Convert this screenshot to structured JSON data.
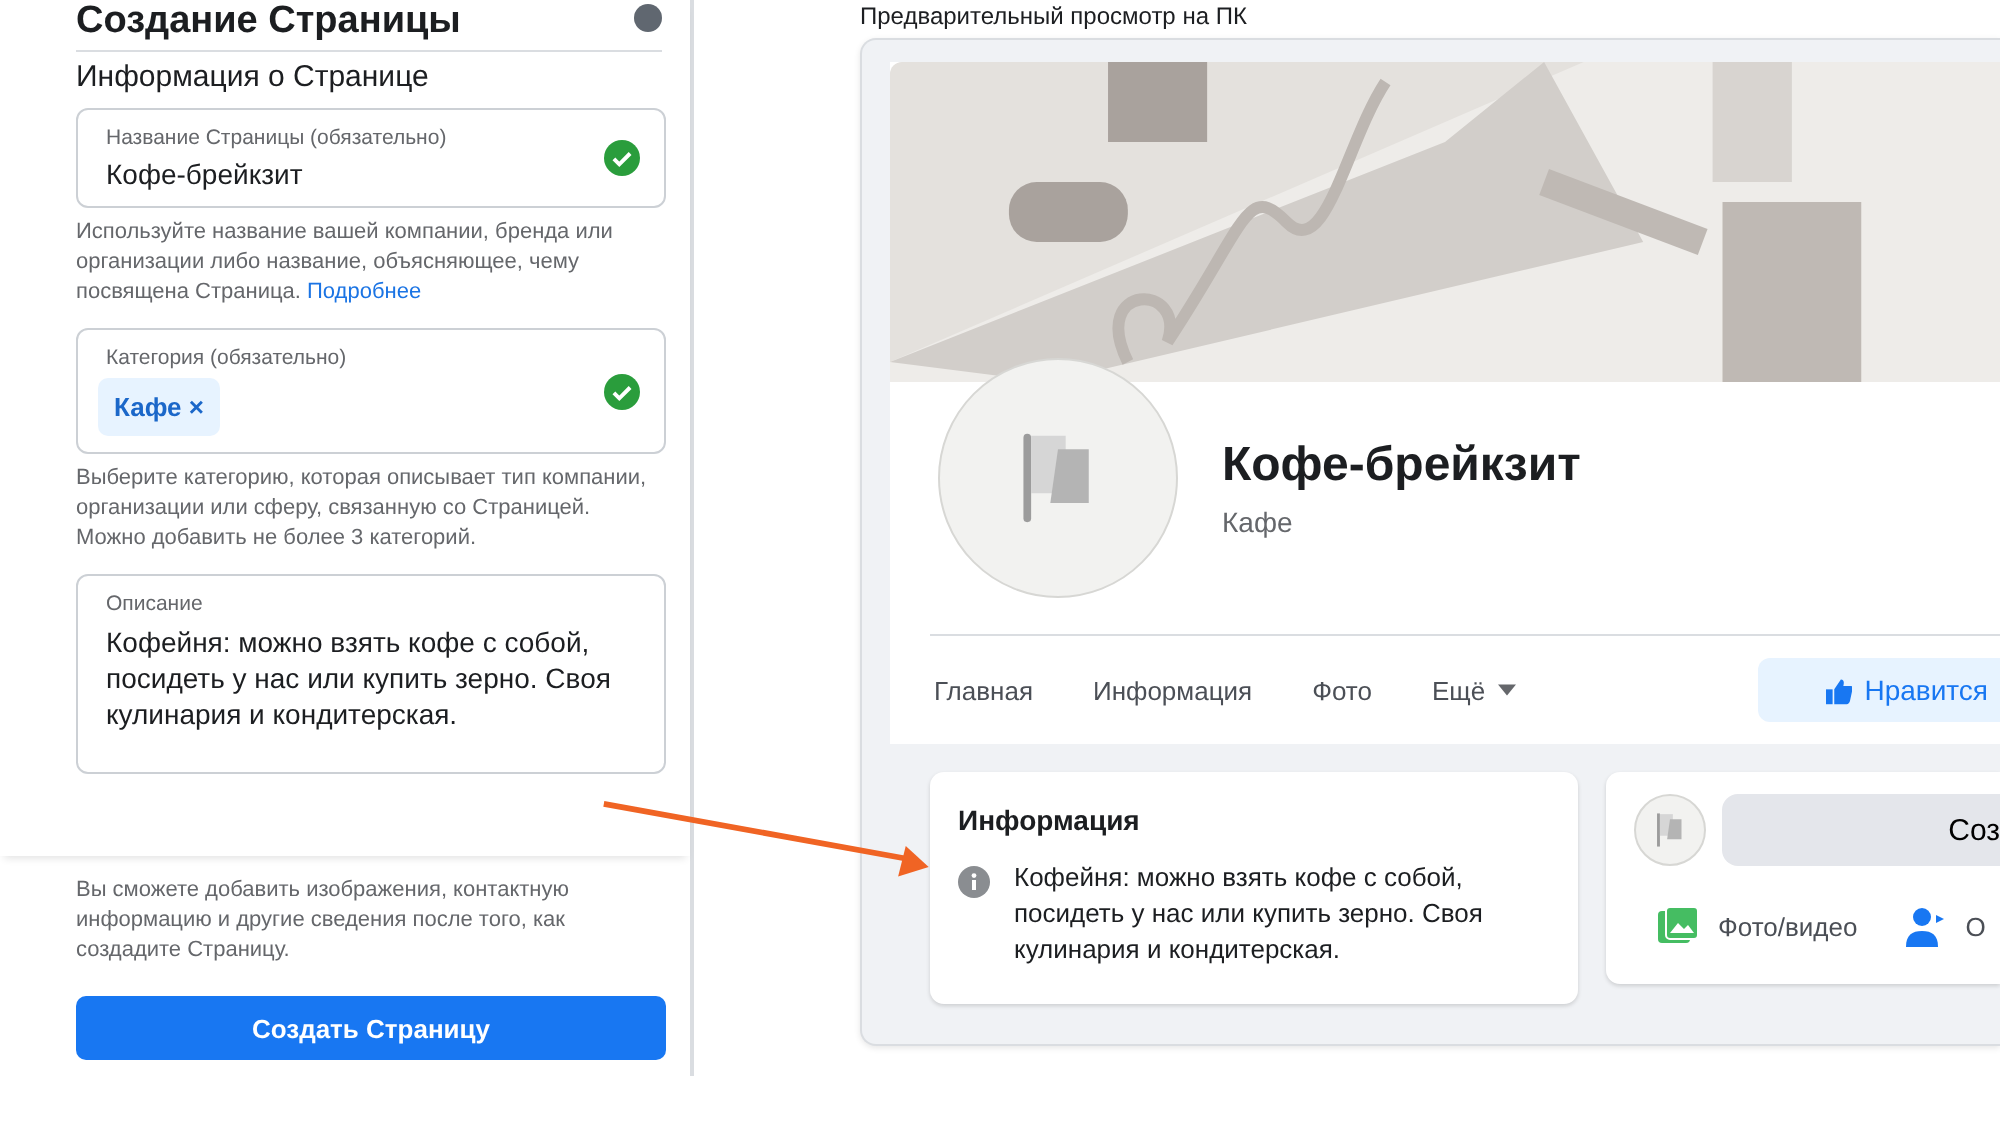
{
  "form": {
    "title": "Создание Страницы",
    "section": "Информация о Странице",
    "name_field": {
      "label": "Название Страницы (обязательно)",
      "value": "Кофе-брейкзит",
      "valid": true
    },
    "name_hint": "Используйте название вашей компании, бренда или организации либо название, объясняющее, чему посвящена Страница.",
    "name_hint_link": "Подробнее",
    "category_field": {
      "label": "Категория (обязательно)",
      "chips": [
        "Кафе"
      ],
      "remove": "×",
      "valid": true
    },
    "category_hint": "Выберите категорию, которая описывает тип компании, организации или сферу, связанную со Страницей. Можно добавить не более 3 категорий.",
    "description_field": {
      "label": "Описание",
      "value": "Кофейня: можно взять кофе с собой, посидеть у нас или купить зерно. Своя кулинария и кондитерская."
    },
    "footnote": "Вы сможете добавить изображения, контактную информацию и другие сведения после того, как создадите Страницу.",
    "submit": "Создать Страницу"
  },
  "preview": {
    "heading": "Предварительный просмотр на ПК",
    "page_name": "Кофе-брейкзит",
    "category": "Кафе",
    "tabs": [
      {
        "label": "Главная",
        "selected": false
      },
      {
        "label": "Информация",
        "selected": false
      },
      {
        "label": "Фото",
        "selected": false
      },
      {
        "label": "Ещё",
        "selected": false,
        "dropdown": true
      }
    ],
    "like_button": "Нравится",
    "info_card": {
      "title": "Информация",
      "text": "Кофейня: можно взять кофе с собой, посидеть у нас или купить зерно. Своя кулинария и кондитерская."
    },
    "composer": {
      "button": "Соз",
      "actions": [
        {
          "kind": "photo",
          "label": "Фото/видео"
        },
        {
          "kind": "person",
          "label": "О"
        }
      ]
    }
  }
}
